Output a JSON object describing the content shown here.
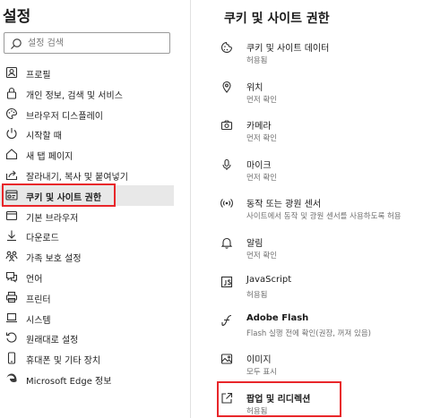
{
  "sidebar": {
    "title": "설정",
    "search_placeholder": "설정 검색",
    "items": [
      {
        "label": "프로필",
        "icon": "profile-icon"
      },
      {
        "label": "개인 정보, 검색 및 서비스",
        "icon": "lock-icon"
      },
      {
        "label": "브라우저 디스플레이",
        "icon": "palette-icon"
      },
      {
        "label": "시작할 때",
        "icon": "power-icon"
      },
      {
        "label": "새 탭 페이지",
        "icon": "home-icon"
      },
      {
        "label": "잘라내기, 복사 및 붙여넣기",
        "icon": "share-icon"
      },
      {
        "label": "쿠키 및 사이트 권한",
        "icon": "site-permissions-icon",
        "active": true
      },
      {
        "label": "기본 브라우저",
        "icon": "browser-icon"
      },
      {
        "label": "다운로드",
        "icon": "download-icon"
      },
      {
        "label": "가족 보호 설정",
        "icon": "family-icon"
      },
      {
        "label": "언어",
        "icon": "language-icon"
      },
      {
        "label": "프린터",
        "icon": "printer-icon"
      },
      {
        "label": "시스템",
        "icon": "system-icon"
      },
      {
        "label": "원래대로 설정",
        "icon": "reset-icon"
      },
      {
        "label": "휴대폰 및 기타 장치",
        "icon": "phone-icon"
      },
      {
        "label": "Microsoft Edge 정보",
        "icon": "edge-icon"
      }
    ]
  },
  "main": {
    "heading": "쿠키 및 사이트 권한",
    "permissions": [
      {
        "title": "쿠키 및 사이트 데이터",
        "status": "허용됨",
        "icon": "cookie-icon"
      },
      {
        "title": "위치",
        "status": "먼저 확인",
        "icon": "location-icon"
      },
      {
        "title": "카메라",
        "status": "먼저 확인",
        "icon": "camera-icon"
      },
      {
        "title": "마이크",
        "status": "먼저 확인",
        "icon": "microphone-icon"
      },
      {
        "title": "동작 또는 광원 센서",
        "status": "사이트에서 동작 및 광원 센서를 사용하도록 허용",
        "icon": "sensor-icon"
      },
      {
        "title": "알림",
        "status": "먼저 확인",
        "icon": "bell-icon"
      },
      {
        "title": "JavaScript",
        "status": "허용됨",
        "icon": "javascript-icon"
      },
      {
        "title": "Adobe Flash",
        "status": "Flash 실행 전에 확인(권장, 꺼져 있음)",
        "icon": "flash-icon"
      },
      {
        "title": "이미지",
        "status": "모두 표시",
        "icon": "image-icon"
      },
      {
        "title": "팝업 및 리디렉션",
        "status": "허용됨",
        "icon": "popup-icon"
      }
    ]
  },
  "highlight_color": "#e8262a"
}
